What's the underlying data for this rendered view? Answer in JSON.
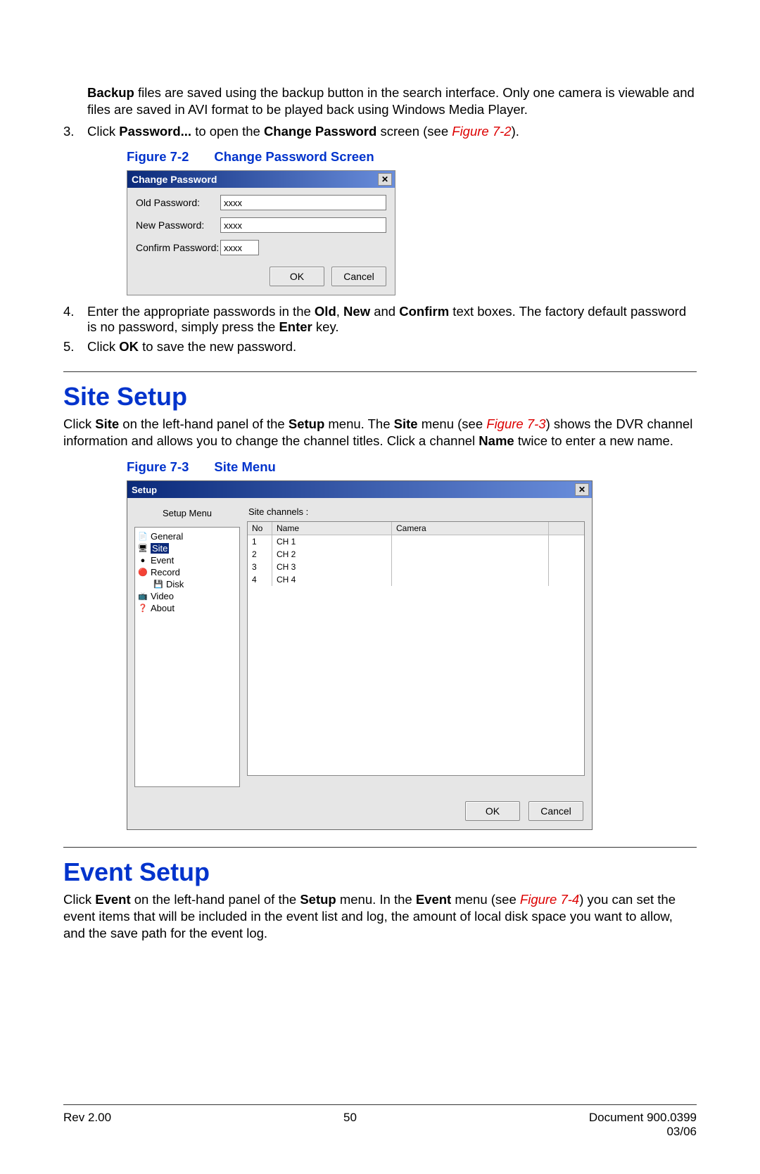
{
  "intro": {
    "backup_text_prefix": "Backup",
    "backup_text_rest": " files are saved using the backup button in the search interface. Only one camera is viewable and files are saved in AVI format to be played back using Windows Media Player."
  },
  "step3": {
    "num": "3.",
    "part1": "Click ",
    "bold1": "Password...",
    "part2": " to open the ",
    "bold2": "Change Password",
    "part3": " screen (see ",
    "figref": "Figure 7-2",
    "part4": ")."
  },
  "fig72": {
    "label_a": "Figure 7-2",
    "label_b": "Change Password Screen",
    "title": "Change Password",
    "old_label": "Old Password:",
    "new_label": "New Password:",
    "confirm_label": "Confirm Password:",
    "masked": "xxxx",
    "ok": "OK",
    "cancel": "Cancel"
  },
  "step4": {
    "num": "4.",
    "part1": "Enter the appropriate passwords in the ",
    "b1": "Old",
    "c1": ", ",
    "b2": "New",
    "c2": " and ",
    "b3": "Confirm",
    "c3": " text boxes. The factory default password is no password, simply press the ",
    "b4": "Enter",
    "c4": " key."
  },
  "step5": {
    "num": "5.",
    "part1": "Click ",
    "b1": "OK",
    "part2": " to save the new password."
  },
  "site": {
    "heading": "Site Setup",
    "p1a": "Click ",
    "p1b": "Site",
    "p1c": " on the left-hand panel of the ",
    "p1d": "Setup",
    "p1e": " menu. The ",
    "p1f": "Site",
    "p1g": " menu (see ",
    "figref": "Figure 7-3",
    "p1h": ") shows the DVR channel information and allows you to change the channel titles. Click a channel ",
    "p1i": "Name",
    "p1j": " twice to enter a new name."
  },
  "fig73": {
    "label_a": "Figure 7-3",
    "label_b": "Site Menu",
    "title": "Setup",
    "menu_title": "Setup Menu",
    "tree": [
      {
        "icon": "📄",
        "text": "General",
        "sel": false,
        "indent": false
      },
      {
        "icon": "🖥",
        "text": "Site",
        "sel": true,
        "indent": false
      },
      {
        "icon": "●",
        "text": "Event",
        "sel": false,
        "indent": false
      },
      {
        "icon": "🔴",
        "text": "Record",
        "sel": false,
        "indent": false
      },
      {
        "icon": "💾",
        "text": "Disk",
        "sel": false,
        "indent": true
      },
      {
        "icon": "📺",
        "text": "Video",
        "sel": false,
        "indent": false
      },
      {
        "icon": "❓",
        "text": "About",
        "sel": false,
        "indent": false
      }
    ],
    "channels_label": "Site channels :",
    "head_no": "No",
    "head_name": "Name",
    "head_cam": "Camera",
    "rows": [
      {
        "no": "1",
        "name": "CH 1",
        "cam": ""
      },
      {
        "no": "2",
        "name": "CH 2",
        "cam": ""
      },
      {
        "no": "3",
        "name": "CH 3",
        "cam": ""
      },
      {
        "no": "4",
        "name": "CH 4",
        "cam": ""
      }
    ],
    "ok": "OK",
    "cancel": "Cancel"
  },
  "event": {
    "heading": "Event Setup",
    "p1a": "Click ",
    "p1b": "Event",
    "p1c": " on the left-hand panel of the ",
    "p1d": "Setup",
    "p1e": " menu. In the ",
    "p1f": "Event",
    "p1g": " menu (see ",
    "figref": "Figure 7-4",
    "p1h": ") you can set the event items that will be included in the event list and log, the amount of local disk space you want to allow, and the save path for the event log."
  },
  "footer": {
    "rev": "Rev 2.00",
    "page": "50",
    "doc": "Document 900.0399",
    "date": "03/06"
  }
}
